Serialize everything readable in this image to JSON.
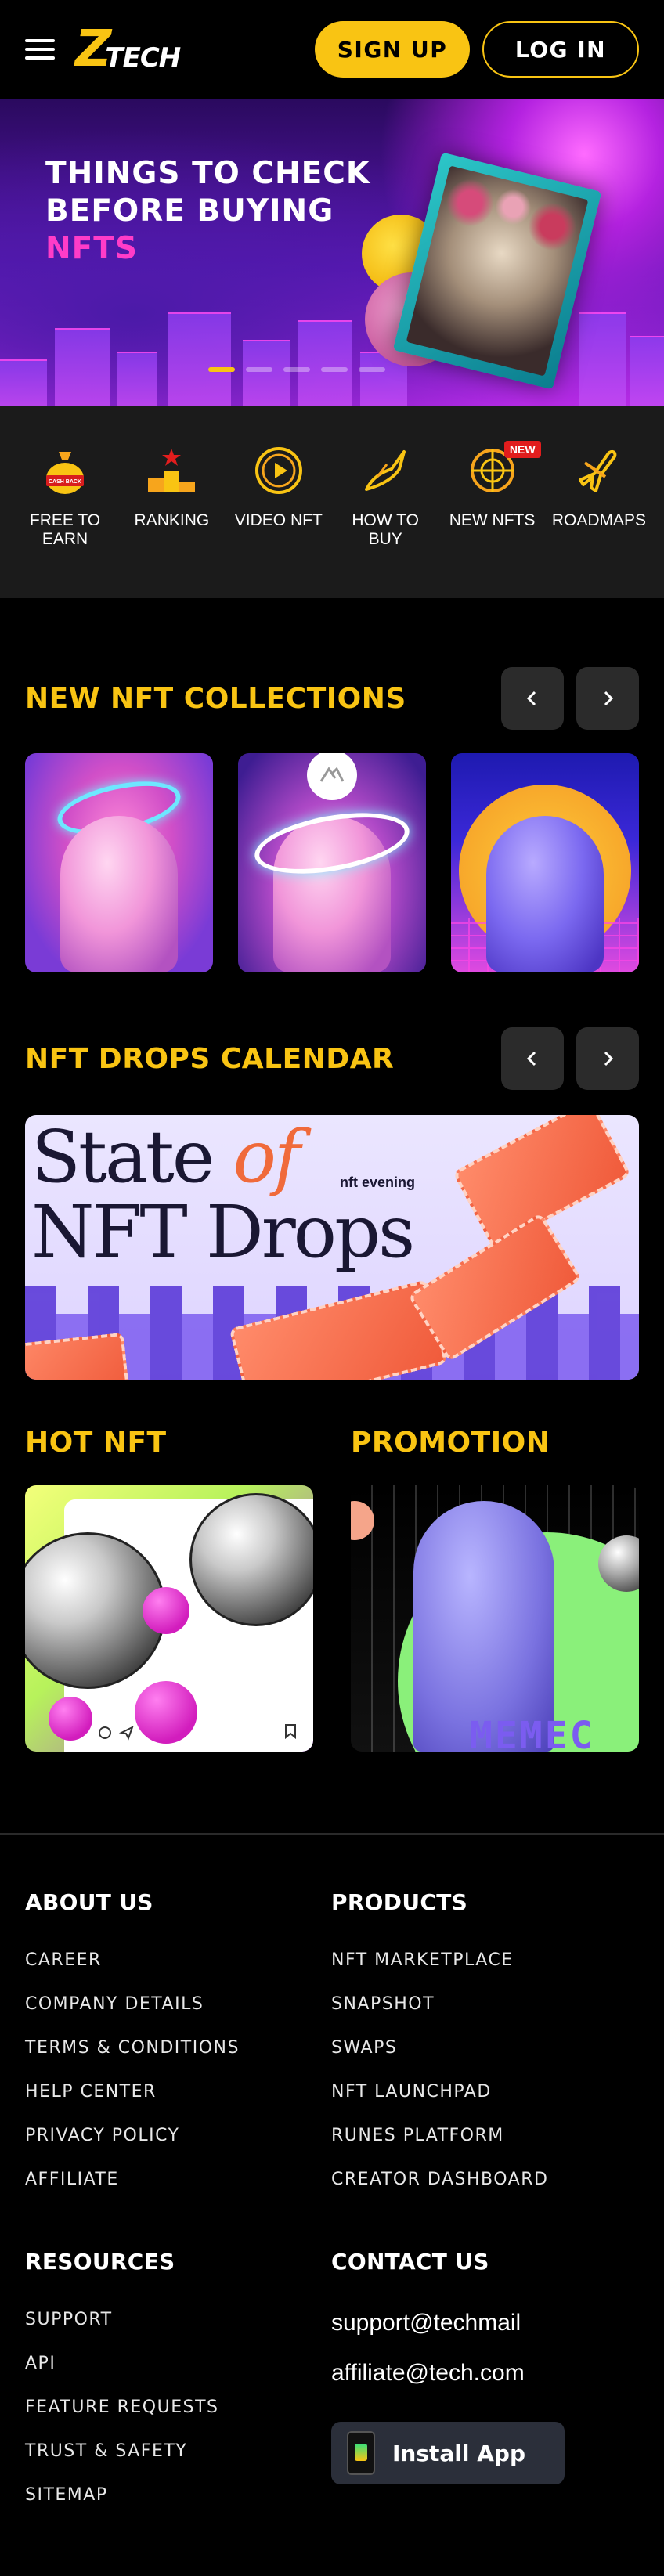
{
  "header": {
    "logo_text": "TECH",
    "signup_label": "SIGN UP",
    "login_label": "LOG IN"
  },
  "hero": {
    "line1": "THINGS TO CHECK",
    "line2": "BEFORE BUYING",
    "line3": "NFTS",
    "slide_count": 5,
    "active_slide": 1
  },
  "categories": [
    {
      "label": "FREE TO EARN",
      "icon": "cashback-bag-icon",
      "sub": "CASH BACK"
    },
    {
      "label": "RANKING",
      "icon": "ranking-podium-icon"
    },
    {
      "label": "VIDEO NFT",
      "icon": "play-circle-icon"
    },
    {
      "label": "HOW TO BUY",
      "icon": "hand-coin-icon"
    },
    {
      "label": "NEW NFTS",
      "icon": "globe-target-icon",
      "badge": "NEW"
    },
    {
      "label": "ROADMAPS",
      "icon": "airplane-icon"
    }
  ],
  "collections": {
    "title": "NEW NFT COLLECTIONS"
  },
  "drops": {
    "title": "NFT DROPS CALENDAR",
    "banner_line1a": "State",
    "banner_line1b": "of",
    "banner_line2": "NFT Drops",
    "banner_brand": "nft evening"
  },
  "hot": {
    "title": "HOT NFT"
  },
  "promotion": {
    "title": "PROMOTION",
    "banner_text": "MEMEC"
  },
  "footer": {
    "about": {
      "title": "ABOUT US",
      "links": [
        "CAREER",
        "COMPANY DETAILS",
        "TERMS & CONDITIONS",
        "HELP CENTER",
        "PRIVACY POLICY",
        "AFFILIATE"
      ]
    },
    "products": {
      "title": "PRODUCTS",
      "links": [
        "NFT MARKETPLACE",
        "SNAPSHOT",
        "SWAPS",
        "NFT LAUNCHPAD",
        "RUNES PLATFORM",
        "CREATOR DASHBOARD"
      ]
    },
    "resources": {
      "title": "RESOURCES",
      "links": [
        "SUPPORT",
        "API",
        "FEATURE REQUESTS",
        "TRUST & SAFETY",
        "SITEMAP"
      ]
    },
    "contact": {
      "title": "CONTACT US",
      "emails": [
        "support@techmail",
        "affiliate@tech.com"
      ],
      "install_label": "Install App"
    }
  },
  "colors": {
    "accent": "#f9c413",
    "background": "#000000",
    "category_bar": "#1b1b1b",
    "new_badge": "#e11d1d"
  }
}
